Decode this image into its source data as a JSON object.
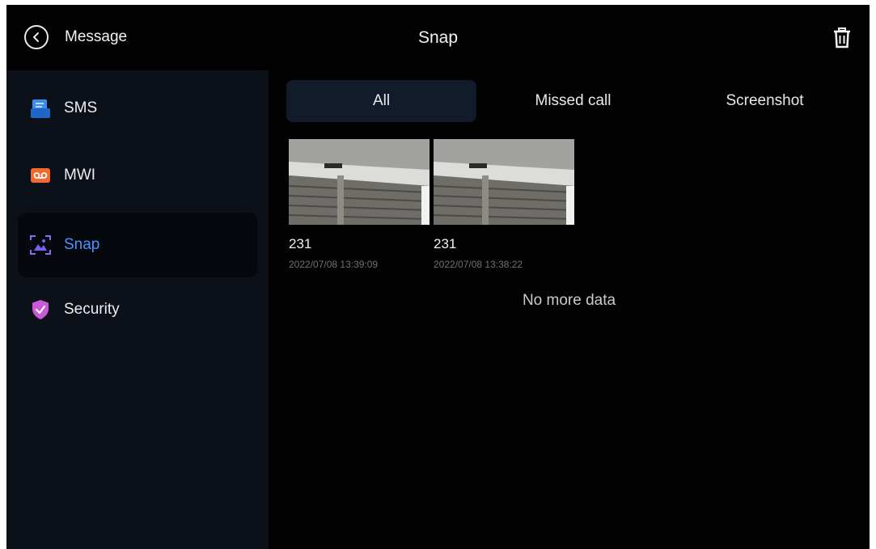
{
  "header": {
    "back_label": "Message",
    "title": "Snap"
  },
  "sidebar": {
    "items": [
      {
        "label": "SMS",
        "icon": "sms-icon",
        "color": "#2f7fe0"
      },
      {
        "label": "MWI",
        "icon": "voicemail-icon",
        "color": "#f2692e"
      },
      {
        "label": "Snap",
        "icon": "image-capture-icon",
        "color": "#7d5ef0",
        "active": true
      },
      {
        "label": "Security",
        "icon": "shield-check-icon",
        "color": "#c95ad6"
      }
    ]
  },
  "tabs": [
    {
      "label": "All",
      "active": true
    },
    {
      "label": "Missed call"
    },
    {
      "label": "Screenshot"
    }
  ],
  "snaps": [
    {
      "name": "231",
      "time": "2022/07/08 13:39:09"
    },
    {
      "name": "231",
      "time": "2022/07/08 13:38:22"
    }
  ],
  "footer_text": "No more data",
  "colors": {
    "background": "#020203",
    "sidebar_bg": "#0c1119",
    "active_accent": "#4a93ff",
    "active_tab_bg": "#121b2a"
  }
}
